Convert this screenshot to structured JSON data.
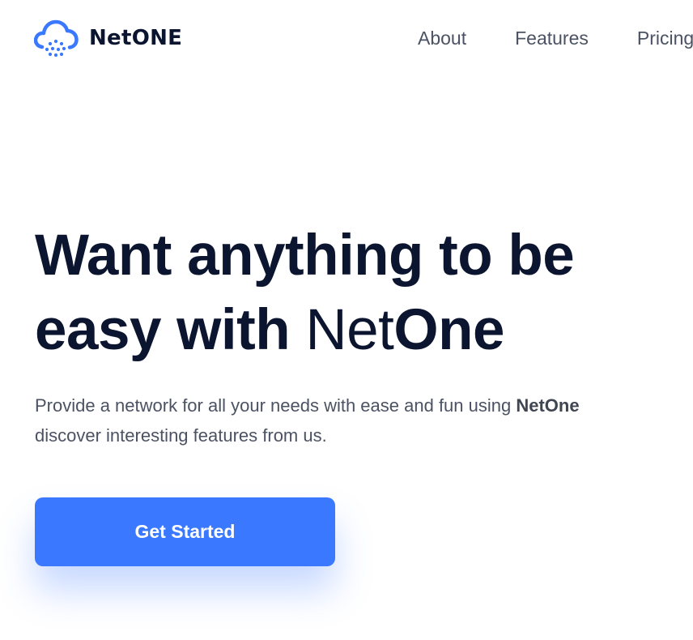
{
  "brand": {
    "name": "NetONE",
    "logo_icon": "cloud-rain-icon",
    "accent_color": "#3a78ff"
  },
  "nav": {
    "items": [
      {
        "label": "About"
      },
      {
        "label": "Features"
      },
      {
        "label": "Pricing"
      }
    ]
  },
  "hero": {
    "title_line1": "Want anything to be",
    "title_line2_bold": "easy with ",
    "title_line2_light": "Net",
    "title_line2_end": "One",
    "desc_part1": "Provide a network for all your needs with ease and fun using ",
    "desc_brand": "NetOne",
    "desc_part2": "discover interesting features from us.",
    "cta_label": "Get Started"
  }
}
